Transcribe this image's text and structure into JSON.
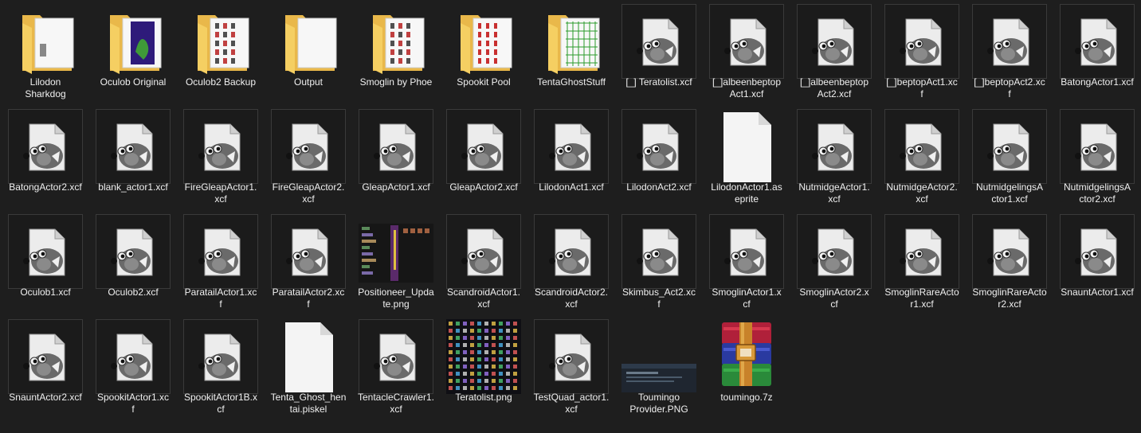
{
  "items": [
    {
      "label": "Lilodon\nSharkdog",
      "type": "folder",
      "preview": "shark"
    },
    {
      "label": "Oculob Original",
      "type": "folder",
      "preview": "green"
    },
    {
      "label": "Oculob2 Backup",
      "type": "folder",
      "preview": "sprites"
    },
    {
      "label": "Output",
      "type": "folder",
      "preview": "none"
    },
    {
      "label": "Smoglin by Phoe",
      "type": "folder",
      "preview": "sprites"
    },
    {
      "label": "Spookit Pool",
      "type": "folder",
      "preview": "red"
    },
    {
      "label": "TentaGhostStuff",
      "type": "folder",
      "preview": "grid"
    },
    {
      "label": "[_] Teratolist.xcf",
      "type": "gimp"
    },
    {
      "label": "[_]albeenbeptop\nAct1.xcf",
      "type": "gimp"
    },
    {
      "label": "[_]albeenbeptop\nAct2.xcf",
      "type": "gimp"
    },
    {
      "label": "[_]beptopAct1.xc\nf",
      "type": "gimp"
    },
    {
      "label": "[_]beptopAct2.xc\nf",
      "type": "gimp"
    },
    {
      "label": "BatongActor1.xcf",
      "type": "gimp"
    },
    {
      "label": "BatongActor2.xcf",
      "type": "gimp"
    },
    {
      "label": "blank_actor1.xcf",
      "type": "gimp"
    },
    {
      "label": "FireGleapActor1.\nxcf",
      "type": "gimp"
    },
    {
      "label": "FireGleapActor2.\nxcf",
      "type": "gimp"
    },
    {
      "label": "GleapActor1.xcf",
      "type": "gimp"
    },
    {
      "label": "GleapActor2.xcf",
      "type": "gimp"
    },
    {
      "label": "LilodonAct1.xcf",
      "type": "gimp"
    },
    {
      "label": "LilodonAct2.xcf",
      "type": "gimp"
    },
    {
      "label": "LilodonActor1.as\neprite",
      "type": "blank"
    },
    {
      "label": "NutmidgeActor1.\nxcf",
      "type": "gimp"
    },
    {
      "label": "NutmidgeActor2.\nxcf",
      "type": "gimp"
    },
    {
      "label": "NutmidgelingsA\nctor1.xcf",
      "type": "gimp"
    },
    {
      "label": "NutmidgelingsA\nctor2.xcf",
      "type": "gimp"
    },
    {
      "label": "Oculob1.xcf",
      "type": "gimp"
    },
    {
      "label": "Oculob2.xcf",
      "type": "gimp"
    },
    {
      "label": "ParatailActor1.xc\nf",
      "type": "gimp"
    },
    {
      "label": "ParatailActor2.xc\nf",
      "type": "gimp"
    },
    {
      "label": "Positioneer_Upda\nte.png",
      "type": "png-positioneer"
    },
    {
      "label": "ScandroidActor1.\nxcf",
      "type": "gimp"
    },
    {
      "label": "ScandroidActor2.\nxcf",
      "type": "gimp"
    },
    {
      "label": "Skimbus_Act2.xc\nf",
      "type": "gimp"
    },
    {
      "label": "SmoglinActor1.x\ncf",
      "type": "gimp"
    },
    {
      "label": "SmoglinActor2.x\ncf",
      "type": "gimp"
    },
    {
      "label": "SmoglinRareActo\nr1.xcf",
      "type": "gimp"
    },
    {
      "label": "SmoglinRareActo\nr2.xcf",
      "type": "gimp"
    },
    {
      "label": "SnauntActor1.xcf",
      "type": "gimp"
    },
    {
      "label": "SnauntActor2.xcf",
      "type": "gimp"
    },
    {
      "label": "SpookitActor1.xc\nf",
      "type": "gimp"
    },
    {
      "label": "SpookitActor1B.x\ncf",
      "type": "gimp"
    },
    {
      "label": "Tenta_Ghost_hen\ntai.piskel",
      "type": "blank"
    },
    {
      "label": "TentacleCrawler1.\nxcf",
      "type": "gimp"
    },
    {
      "label": "Teratolist.png",
      "type": "png-teratolist"
    },
    {
      "label": "TestQuad_actor1.\nxcf",
      "type": "gimp"
    },
    {
      "label": "Toumingo\nProvider.PNG",
      "type": "png-screenshot"
    },
    {
      "label": "toumingo.7z",
      "type": "archive"
    }
  ],
  "colors": {
    "background": "#1e1e1e",
    "text": "#f0f0f0",
    "folder": "#f5cf62",
    "tile_border": "#3a3a3a"
  }
}
